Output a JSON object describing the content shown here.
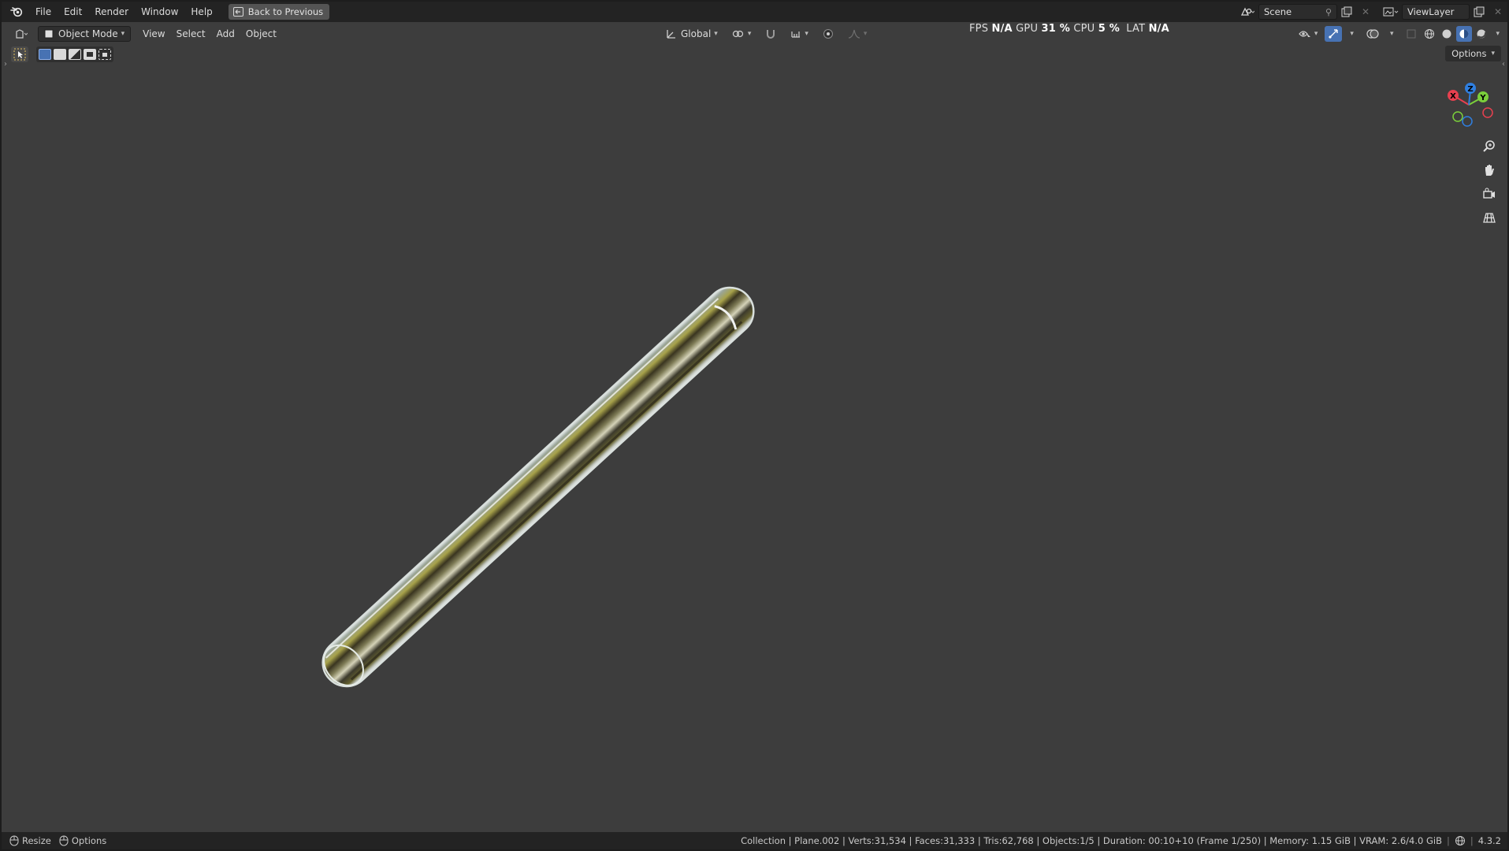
{
  "menu": {
    "items": [
      "File",
      "Edit",
      "Render",
      "Window",
      "Help"
    ],
    "back_label": "Back to Previous"
  },
  "scene": {
    "label": "Scene"
  },
  "view_layer": {
    "label": "ViewLayer"
  },
  "perf": {
    "fps_label": "FPS",
    "fps_value": "N/A",
    "gpu_label": "GPU",
    "gpu_value": "31 %",
    "cpu_label": "CPU",
    "cpu_value": "5 %",
    "lat_label": "LAT",
    "lat_value": "N/A"
  },
  "header": {
    "mode": "Object Mode",
    "view": "View",
    "select": "Select",
    "add": "Add",
    "object": "Object",
    "orientation": "Global",
    "options": "Options"
  },
  "gizmo": {
    "x": "X",
    "y": "Y",
    "z": "Z"
  },
  "status": {
    "resize": "Resize",
    "options": "Options",
    "info": "Collection | Plane.002 | Verts:31,534 | Faces:31,333 | Tris:62,768 | Objects:1/5 | Duration: 00:10+10 (Frame 1/250) | Memory: 1.15 GiB | VRAM: 2.6/4.0 GiB",
    "version": "4.3.2"
  },
  "colors": {
    "viewport_bg": "#3d3d3d",
    "topbar_bg": "#232323",
    "axis_x": "#e8404f",
    "axis_y": "#7bd03b",
    "axis_z": "#2f7fe0",
    "select_accent": "#4772b3"
  }
}
